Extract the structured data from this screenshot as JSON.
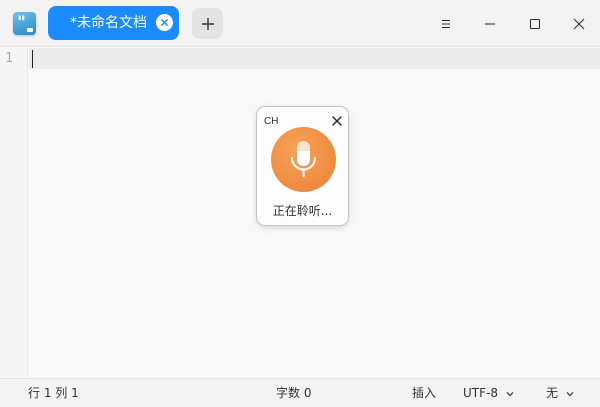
{
  "tabs": [
    {
      "label": "*未命名文档",
      "active": true
    }
  ],
  "editor": {
    "line_numbers": [
      "1"
    ]
  },
  "voice_input": {
    "language": "CH",
    "status": "正在聆听..."
  },
  "statusbar": {
    "position": "行 1  列 1",
    "word_count": "字数 0",
    "insert_mode": "插入",
    "encoding": "UTF-8",
    "highlight": "无"
  },
  "colors": {
    "accent": "#1a8cff",
    "mic": "#ed7f33"
  },
  "icons": {
    "app": "text-editor-icon",
    "tab_close": "close-icon",
    "new_tab": "plus-icon",
    "menu": "menu-icon",
    "minimize": "minimize-icon",
    "maximize": "maximize-icon",
    "close": "close-icon",
    "mic": "microphone-icon"
  }
}
